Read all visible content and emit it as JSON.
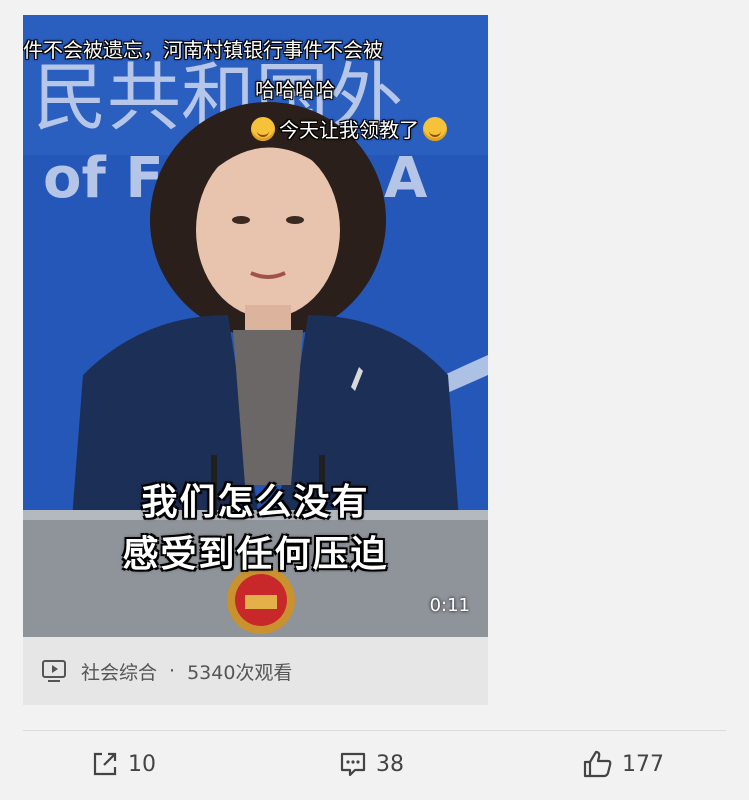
{
  "video": {
    "overlay_line1": "件不会被遗忘，河南村镇银行事件不会被",
    "overlay_line2": "哈哈哈哈",
    "overlay_line3": "今天让我领教了",
    "subtitle_line1": "我们怎么没有",
    "subtitle_line2": "感受到任何压迫",
    "duration": "0:11",
    "category": "社会综合",
    "separator": "·",
    "views": "5340次观看"
  },
  "actions": {
    "share_count": "10",
    "comment_count": "38",
    "like_count": "177"
  },
  "icons": {
    "play": "video-play-icon",
    "share": "share-icon",
    "comment": "comment-icon",
    "like": "thumbs-up-icon"
  },
  "colors": {
    "backdrop_blue": "#2457b8",
    "page_bg": "#f2f2f2",
    "card_bg": "#e6e6e6"
  }
}
